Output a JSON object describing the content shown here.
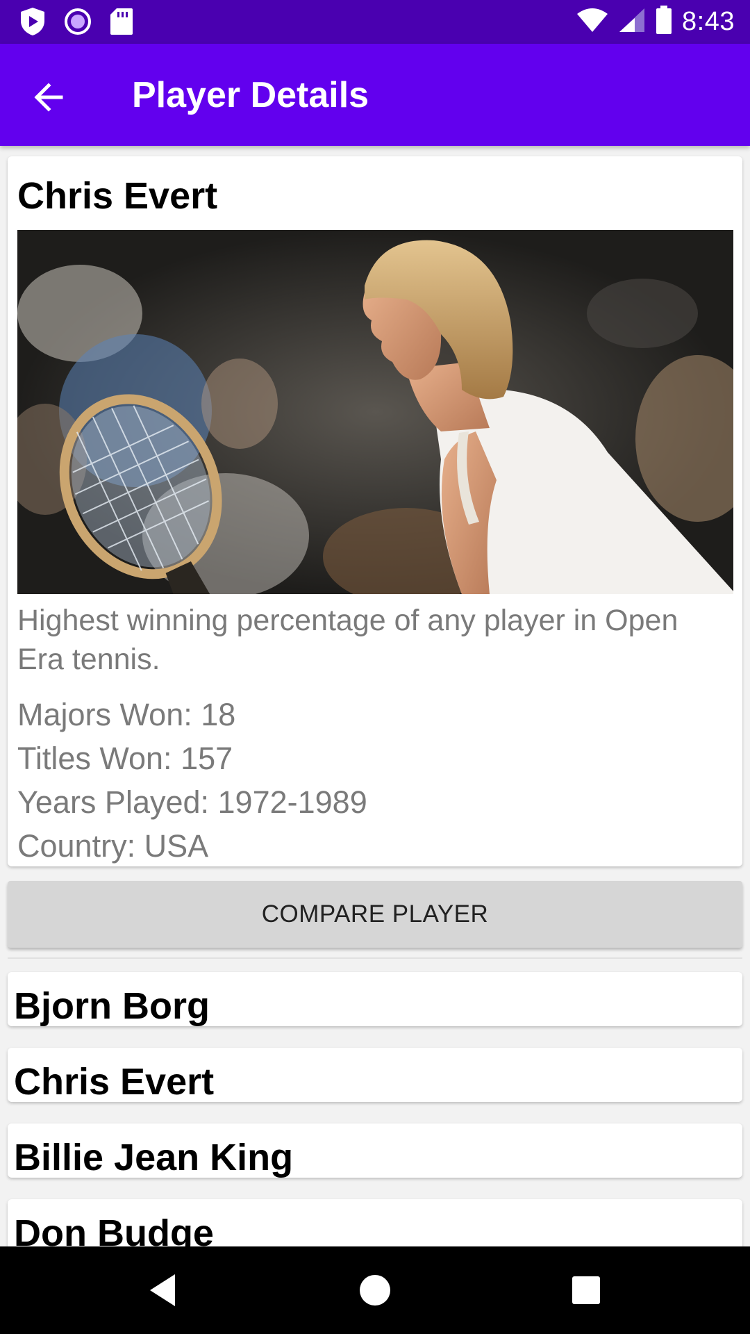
{
  "status_bar": {
    "time": "8:43",
    "left_icons": [
      "play-protect-icon",
      "record-icon",
      "sd-card-icon"
    ],
    "right_icons": [
      "wifi-icon",
      "signal-icon",
      "battery-icon"
    ]
  },
  "app_bar": {
    "title": "Player Details",
    "back_icon": "arrow-back-icon",
    "color": "#6200ee",
    "status_color": "#4a00b0"
  },
  "player": {
    "name": "Chris Evert",
    "description": "Highest winning percentage of any player in Open Era tennis.",
    "stats": [
      "Majors Won: 18",
      "Titles Won: 157",
      "Years Played: 1972-1989",
      "Country: USA"
    ]
  },
  "compare_button": {
    "label": "COMPARE PLAYER"
  },
  "player_list": [
    {
      "name": "Bjorn Borg"
    },
    {
      "name": "Chris Evert"
    },
    {
      "name": "Billie Jean King"
    },
    {
      "name": "Don Budge"
    }
  ],
  "nav_bar": {
    "icons": [
      "back-triangle-icon",
      "home-circle-icon",
      "recents-square-icon"
    ]
  }
}
